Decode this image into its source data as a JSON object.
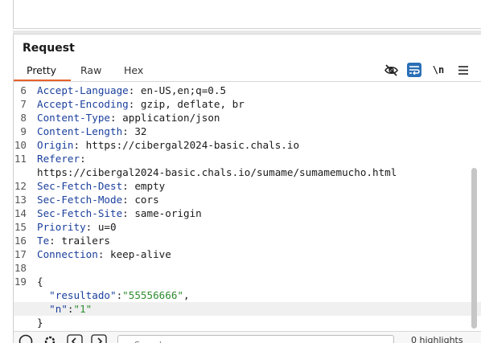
{
  "panel": {
    "title": "Request",
    "tabs": [
      {
        "label": "Pretty",
        "active": true
      },
      {
        "label": "Raw",
        "active": false
      },
      {
        "label": "Hex",
        "active": false
      }
    ],
    "toolbar": {
      "hide_icon": "eye-slash-icon",
      "wrap_icon": "word-wrap-icon",
      "newline_label": "\\n",
      "menu_icon": "hamburger-menu-icon"
    }
  },
  "editor": {
    "lines": [
      {
        "n": "6",
        "key": "Accept-Language",
        "sep": ": ",
        "val": "en-US,en;q=0.5"
      },
      {
        "n": "7",
        "key": "Accept-Encoding",
        "sep": ": ",
        "val": "gzip, deflate, br"
      },
      {
        "n": "8",
        "key": "Content-Type",
        "sep": ": ",
        "val": "application/json"
      },
      {
        "n": "9",
        "key": "Content-Length",
        "sep": ": ",
        "val": "32"
      },
      {
        "n": "10",
        "key": "Origin",
        "sep": ": ",
        "val": "https://cibergal2024-basic.chals.io"
      },
      {
        "n": "11",
        "key": "Referer",
        "sep": ":",
        "val": ""
      },
      {
        "n": "",
        "key": "",
        "sep": "",
        "val": "https://cibergal2024-basic.chals.io/sumame/sumamemucho.html"
      },
      {
        "n": "12",
        "key": "Sec-Fetch-Dest",
        "sep": ": ",
        "val": "empty"
      },
      {
        "n": "13",
        "key": "Sec-Fetch-Mode",
        "sep": ": ",
        "val": "cors"
      },
      {
        "n": "14",
        "key": "Sec-Fetch-Site",
        "sep": ": ",
        "val": "same-origin"
      },
      {
        "n": "15",
        "key": "Priority",
        "sep": ": ",
        "val": "u=0"
      },
      {
        "n": "16",
        "key": "Te",
        "sep": ": ",
        "val": "trailers"
      },
      {
        "n": "17",
        "key": "Connection",
        "sep": ": ",
        "val": "keep-alive"
      },
      {
        "n": "18",
        "key": "",
        "sep": "",
        "val": ""
      },
      {
        "n": "19",
        "key": "",
        "sep": "",
        "val": "{"
      },
      {
        "n": "",
        "json_key": "\"resultado\"",
        "json_sep": ":",
        "json_val": "\"55556666\"",
        "json_end": ","
      },
      {
        "n": "",
        "json_key": "\"n\"",
        "json_sep": ":",
        "json_val": "\"1\"",
        "json_end": "",
        "active": true
      },
      {
        "n": "",
        "key": "",
        "sep": "",
        "val": "}"
      }
    ]
  },
  "bottom": {
    "help_icon": "help-circle-icon",
    "settings_icon": "gear-icon",
    "back_icon": "chevron-left-icon",
    "forward_icon": "chevron-right-icon",
    "search_placeholder": "Search",
    "highlights_label": "0 highlights"
  }
}
